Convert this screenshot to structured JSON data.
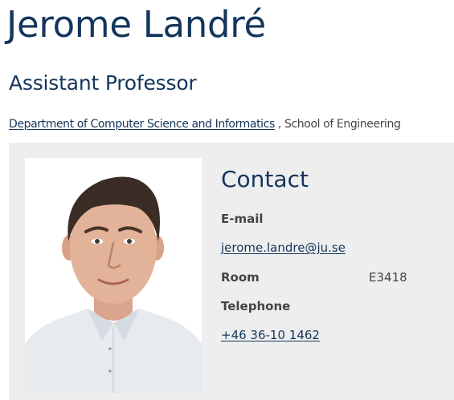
{
  "profile": {
    "name": "Jerome Landré",
    "title": "Assistant Professor",
    "department_link": "Department of Computer Science and Informatics",
    "school_text": " , School of Engineering"
  },
  "contact": {
    "heading": "Contact",
    "email_label": "E-mail",
    "email_value": "jerome.landre@ju.se",
    "room_label": "Room",
    "room_value": "E3418",
    "telephone_label": "Telephone",
    "telephone_value": "+46 36-10 1462"
  },
  "colors": {
    "heading_blue": "#13365c",
    "panel_gray": "#eeeeee",
    "body_text": "#444444"
  }
}
